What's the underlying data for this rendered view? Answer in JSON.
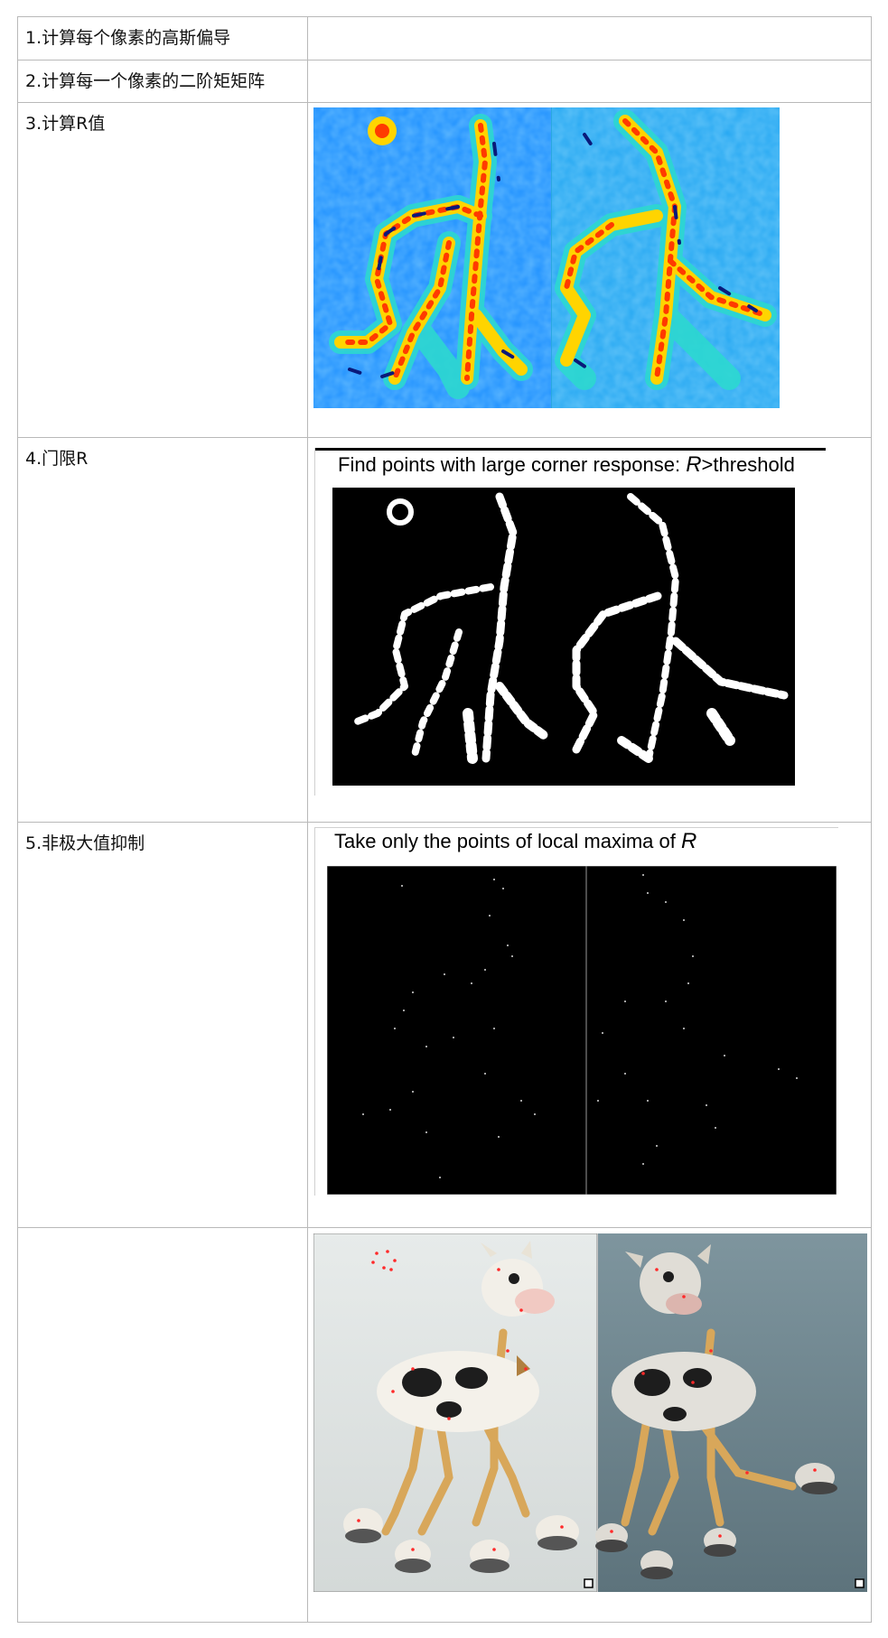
{
  "steps": [
    {
      "label": "1.计算每个像素的高斯偏导"
    },
    {
      "label": "2.计算每一个像素的二阶矩矩阵"
    },
    {
      "label": "3.计算R值"
    },
    {
      "label": "4.门限R",
      "figure_caption": "Find points with large corner response: ",
      "figure_caption_var": "R",
      "figure_caption_suffix": ">threshold"
    },
    {
      "label": "5.非极大值抑制",
      "figure_caption": "Take only the points of local maxima of ",
      "figure_caption_var": "R"
    },
    {
      "label": ""
    }
  ],
  "colors": {
    "border": "#b9b9b9",
    "heat_low": "#1e90ff",
    "heat_mid": "#2cd8d0",
    "heat_warm": "#ffd400",
    "heat_hot": "#ff3a00",
    "heat_edge": "#0a1a7a",
    "threshold_bg": "#000000",
    "threshold_fg": "#ffffff",
    "photo_wall_left": "#dfe4e2",
    "photo_wall_right": "#6f8791",
    "corner_marker": "#ff2a2a"
  }
}
